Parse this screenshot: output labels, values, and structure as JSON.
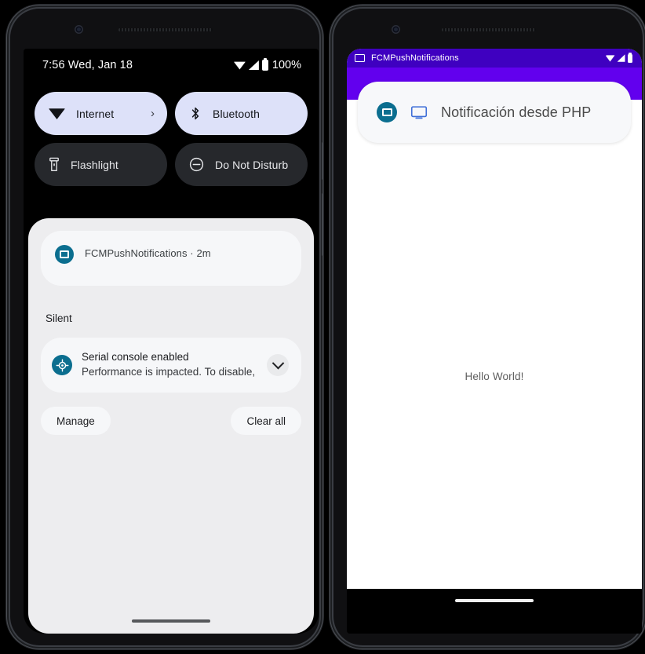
{
  "left_phone": {
    "status_bar": {
      "clock": "7:56 Wed, Jan 18",
      "battery_percent": "100%",
      "icons": [
        "wifi-icon",
        "signal-icon",
        "battery-icon"
      ]
    },
    "quick_settings": {
      "tiles": [
        {
          "label": "Internet",
          "icon": "wifi-icon",
          "state": "on",
          "chevron": "›"
        },
        {
          "label": "Bluetooth",
          "icon": "bluetooth-icon",
          "state": "on"
        },
        {
          "label": "Flashlight",
          "icon": "flashlight-icon",
          "state": "off"
        },
        {
          "label": "Do Not Disturb",
          "icon": "do-not-disturb-icon",
          "state": "off"
        }
      ]
    },
    "shade": {
      "app_notification": {
        "app_name": "FCMPushNotifications · 2m",
        "icon": "monitor-app-icon"
      },
      "section_label": "Silent",
      "system_notification": {
        "title": "Serial console enabled",
        "body": "Performance is impacted. To disable, …",
        "icon": "android-bug-icon",
        "expand_icon": "chevron-down-icon"
      },
      "manage_label": "Manage",
      "clear_all_label": "Clear all"
    }
  },
  "right_phone": {
    "app_status_bar": {
      "app_name": "FCMPushNotifications",
      "icon": "monitor-app-icon",
      "icons": [
        "wifi-icon",
        "signal-icon",
        "battery-icon"
      ]
    },
    "heads_up_notification": {
      "title": "Notificación desde PHP",
      "app_icon": "monitor-app-icon",
      "small_icon": "monitor-icon"
    },
    "content": {
      "hello_text": "Hello World!"
    }
  },
  "colors": {
    "tile_on_bg": "#dde1f9",
    "tile_off_bg": "#26282c",
    "shade_bg": "#ededef",
    "card_bg": "#f6f7f9",
    "app_icon_teal": "#0b6e8f",
    "status_purple": "#3f00c0",
    "appbar_purple": "#6200ee",
    "phone_body": "#101012"
  }
}
